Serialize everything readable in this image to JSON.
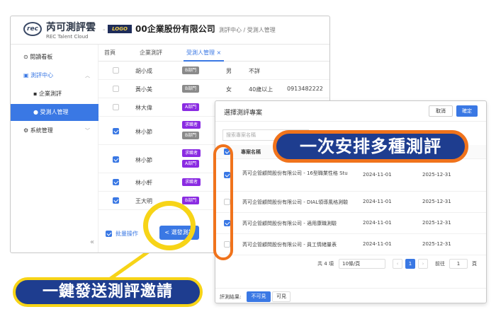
{
  "header": {
    "brand": "芮可測評雲",
    "brand_sub": "REC Talent Cloud",
    "logo_text": "rec",
    "company_logo": "LOGO",
    "company": "00企業股份有限公司",
    "breadcrumb": "測評中心 / 受測人管理"
  },
  "sidebar": {
    "items": [
      {
        "label": "閱讀看板",
        "icon": "dashboard-icon"
      },
      {
        "label": "測評中心",
        "icon": "assessment-icon"
      },
      {
        "label": "企業測評",
        "icon": "clipboard-icon"
      },
      {
        "label": "受測人管理",
        "icon": "user-icon"
      },
      {
        "label": "系統管理",
        "icon": "settings-icon"
      }
    ],
    "collapse": "«"
  },
  "tabs": [
    {
      "label": "首頁"
    },
    {
      "label": "企業測評"
    },
    {
      "label": "受測人管理 ×"
    }
  ],
  "rows": [
    {
      "name": "胡小成",
      "tags": [
        "B部門"
      ],
      "gender": "男",
      "age": "不詳",
      "phone": "",
      "checked": false
    },
    {
      "name": "黃小美",
      "tags": [
        "B部門"
      ],
      "gender": "女",
      "age": "40歲以上",
      "phone": "0913482222",
      "checked": false
    },
    {
      "name": "林大偉",
      "tags": [
        "A部門"
      ],
      "gender": "",
      "age": "",
      "phone": "",
      "checked": false
    },
    {
      "name": "林小節",
      "tags": [
        "求職者",
        "B部門"
      ],
      "gender": "",
      "age": "",
      "phone": "",
      "checked": true
    },
    {
      "name": "林小節",
      "tags": [
        "求職者",
        "A部門"
      ],
      "gender": "",
      "age": "",
      "phone": "",
      "checked": true
    },
    {
      "name": "林小軒",
      "tags": [
        "求職者"
      ],
      "gender": "",
      "age": "",
      "phone": "",
      "checked": true
    },
    {
      "name": "王大明",
      "tags": [
        "B部門"
      ],
      "gender": "",
      "age": "",
      "phone": "",
      "checked": true
    }
  ],
  "bulk_ops": "批量操作",
  "send_button": "< 選發測評",
  "popup": {
    "title": "選擇測評專案",
    "cancel": "取消",
    "confirm": "確定",
    "search_placeholder": "搜索專案名稱",
    "column": "專案名稱",
    "rows": [
      {
        "name": "芮可企管顧問股份有限公司 - 16型職業性格 Stu",
        "start": "2024-11-01",
        "end": "2025-12-31",
        "checked": true
      },
      {
        "name": "芮可企管顧問股份有限公司 - DIAL領導風格測驗",
        "start": "2024-11-01",
        "end": "2025-12-31",
        "checked": false
      },
      {
        "name": "芮可企管顧問股份有限公司 - 適用康職測驗",
        "start": "2024-11-01",
        "end": "2025-12-31",
        "checked": true
      },
      {
        "name": "芮可企管顧問股份有限公司 - 員工情緒量表",
        "start": "2024-11-01",
        "end": "2025-12-31",
        "checked": false
      }
    ],
    "total": "共 4 項",
    "page_size": "10條/頁",
    "page": "1",
    "goto_label": "前往",
    "goto_value": "1",
    "page_unit": "頁",
    "visibility_label": "評測結果:",
    "visibility_options": [
      "不可見",
      "可見"
    ]
  },
  "callouts": {
    "multi": "一次安排多種測評",
    "one_click": "一鍵發送測評邀請"
  },
  "colors": {
    "primary": "#3a78e4",
    "callout_bg": "#1e3d8f",
    "orange": "#f0731c",
    "yellow": "#f7d417"
  }
}
